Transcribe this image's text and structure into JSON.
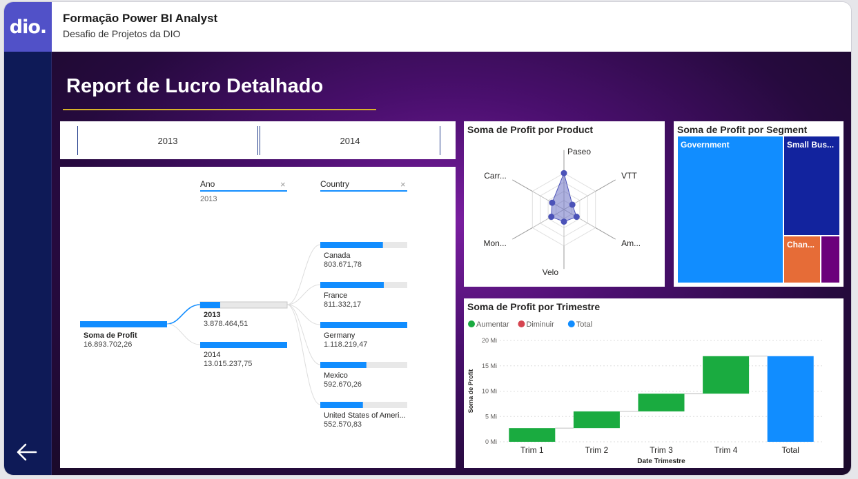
{
  "header": {
    "logo": "dio.",
    "title": "Formação Power BI Analyst",
    "subtitle": "Desafio de Projetos da DIO"
  },
  "report": {
    "title": "Report de Lucro Detalhado",
    "slicer": {
      "options": [
        "2013",
        "2014"
      ]
    }
  },
  "decomposition": {
    "root": {
      "label": "Soma de Profit",
      "value": "16.893.702,26"
    },
    "levels": [
      {
        "name": "Ano",
        "selected": "2013"
      },
      {
        "name": "Country",
        "selected": ""
      }
    ],
    "years": [
      {
        "label": "2013",
        "value": "3.878.464,51",
        "fill": 0.23
      },
      {
        "label": "2014",
        "value": "13.015.237,75",
        "fill": 1.0
      }
    ],
    "countries": [
      {
        "label": "Canada",
        "value": "803.671,78",
        "fill": 0.72
      },
      {
        "label": "France",
        "value": "811.332,17",
        "fill": 0.73
      },
      {
        "label": "Germany",
        "value": "1.118.219,47",
        "fill": 1.0
      },
      {
        "label": "Mexico",
        "value": "592.670,26",
        "fill": 0.53
      },
      {
        "label": "United States of Ameri...",
        "value": "552.570,83",
        "fill": 0.49
      }
    ]
  },
  "chart_data": [
    {
      "type": "radar",
      "title": "Soma de Profit por Product",
      "categories": [
        "Paseo",
        "VTT",
        "Am...",
        "Velo",
        "Mon...",
        "Carr..."
      ],
      "values": [
        0.75,
        0.2,
        0.3,
        0.25,
        0.3,
        0.28
      ],
      "color": "#4b52b8"
    },
    {
      "type": "treemap",
      "title": "Soma de Profit por Segment",
      "segments": [
        {
          "label": "Government",
          "value": 0.52,
          "color": "#118dff"
        },
        {
          "label": "Small Bus...",
          "value": 0.3,
          "color": "#12239e"
        },
        {
          "label": "Chan...",
          "value": 0.11,
          "color": "#e66c37"
        },
        {
          "label": "",
          "value": 0.07,
          "color": "#6b007b"
        }
      ]
    },
    {
      "type": "waterfall",
      "title": "Soma de Profit por Trimestre",
      "legend": [
        {
          "label": "Aumentar",
          "color": "#1aab40"
        },
        {
          "label": "Diminuir",
          "color": "#d64550"
        },
        {
          "label": "Total",
          "color": "#118dff"
        }
      ],
      "categories": [
        "Trim 1",
        "Trim 2",
        "Trim 3",
        "Trim 4",
        "Total"
      ],
      "increments": [
        2.7,
        3.3,
        3.5,
        7.4
      ],
      "total": 16.9,
      "yticks": [
        "0 Mi",
        "5 Mi",
        "10 Mi",
        "15 Mi",
        "20 Mi"
      ],
      "ylim": [
        0,
        20
      ],
      "xlabel": "Date Trimestre",
      "ylabel": "Soma de Profit"
    }
  ]
}
